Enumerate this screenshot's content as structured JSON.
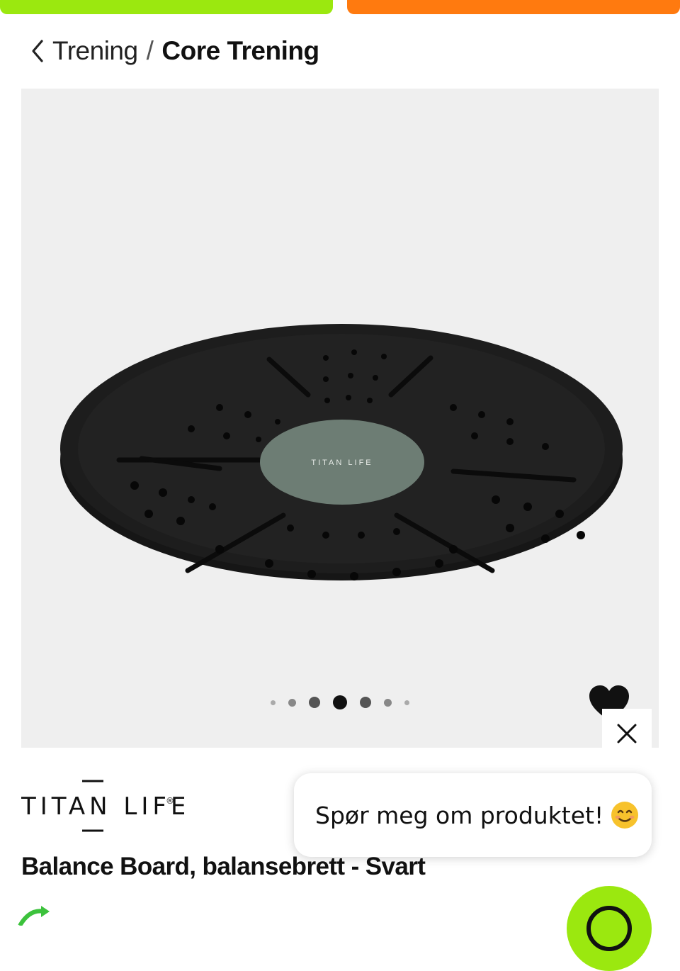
{
  "breadcrumb": {
    "parent": "Trening",
    "separator": "/",
    "current": "Core Trening"
  },
  "gallery": {
    "board_label": "TITAN LIFE",
    "image_count": 7,
    "active_index": 3
  },
  "brand": {
    "name": "TITAN LIFE"
  },
  "chat": {
    "prompt": "Spør meg om produktet!"
  },
  "product": {
    "title": "Balance Board, balansebrett - Svart"
  },
  "colors": {
    "accent_green": "#9be80f",
    "accent_orange": "#ff7a0f",
    "gallery_bg": "#efefef",
    "board_black": "#1c1c1c",
    "board_center": "#6d7d74"
  },
  "icons": {
    "back": "chevron-left-icon",
    "favorite": "heart-icon",
    "close": "close-icon",
    "emoji": "smiling-face-emoji",
    "chat": "chat-icon",
    "shipping": "recycle-icon"
  }
}
